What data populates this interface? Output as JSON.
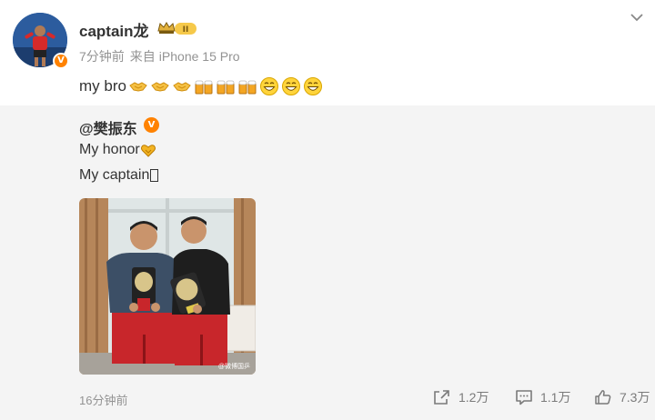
{
  "post": {
    "username": "captain龙",
    "vip_level": "II",
    "time": "7分钟前",
    "source_prefix": "来自",
    "device": "iPhone 15 Pro",
    "text": "my bro",
    "emojis": [
      "handshake-emoji",
      "handshake-emoji",
      "handshake-emoji",
      "beer-emoji",
      "beer-emoji",
      "beer-emoji",
      "grin-emoji",
      "grin-emoji",
      "grin-emoji"
    ]
  },
  "repost": {
    "author": "@樊振东",
    "line1": "My honor",
    "line2": "My captain",
    "photo_watermark": "@微博国乒",
    "time": "16分钟前",
    "shares": "1.2万",
    "comments": "1.1万",
    "likes": "7.3万"
  },
  "colors": {
    "accent_orange": "#ff8200",
    "muted_text": "#939393",
    "repost_bg": "#f4f4f4"
  },
  "icons": {
    "collapse": "chevron-down-icon",
    "share": "share-icon",
    "comment": "comment-icon",
    "like": "thumbs-up-icon"
  }
}
